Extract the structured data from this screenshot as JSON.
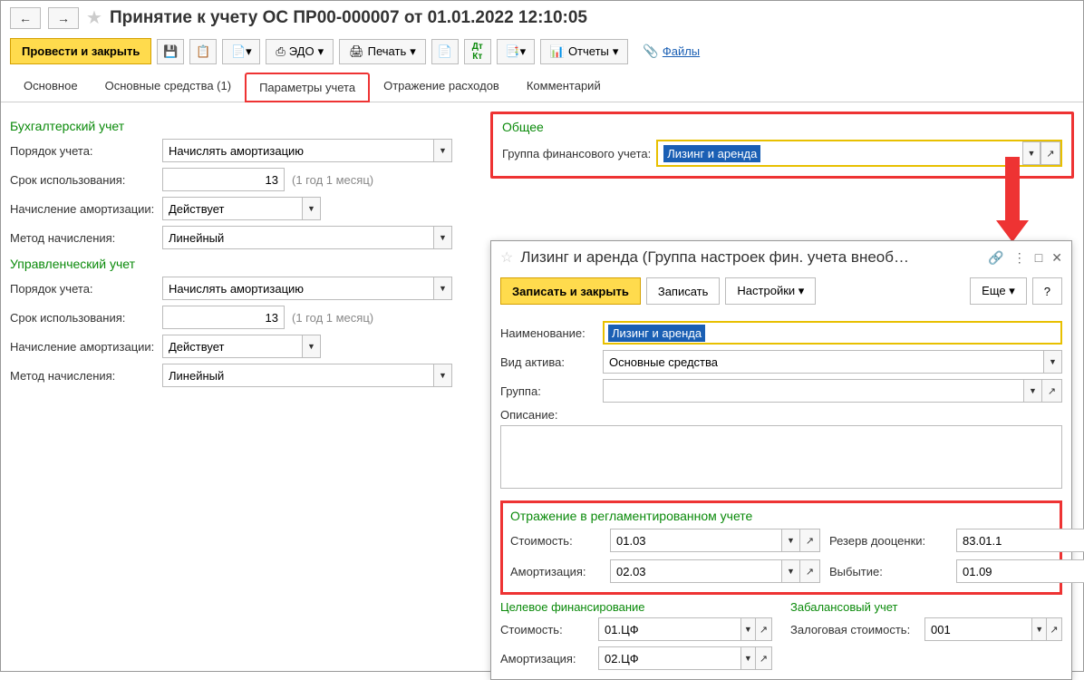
{
  "title": "Принятие к учету ОС ПР00-000007 от 01.01.2022 12:10:05",
  "toolbar": {
    "post_close": "Провести и закрыть",
    "edo": "ЭДО",
    "print": "Печать",
    "reports": "Отчеты",
    "files": "Файлы"
  },
  "tabs": {
    "main": "Основное",
    "assets": "Основные средства (1)",
    "params": "Параметры учета",
    "expenses": "Отражение расходов",
    "comment": "Комментарий"
  },
  "left": {
    "acc_title": "Бухгалтерский учет",
    "order_label": "Порядок учета:",
    "order_value": "Начислять амортизацию",
    "term_label": "Срок использования:",
    "term_value": "13",
    "term_hint": "(1 год 1 месяц)",
    "amort_label": "Начисление амортизации:",
    "amort_value": "Действует",
    "method_label": "Метод начисления:",
    "method_value": "Линейный",
    "mgmt_title": "Управленческий учет",
    "m_order_value": "Начислять амортизацию",
    "m_term_value": "13",
    "m_term_hint": "(1 год 1 месяц)",
    "m_amort_value": "Действует",
    "m_method_value": "Линейный"
  },
  "right": {
    "general_title": "Общее",
    "fingroup_label": "Группа финансового учета:",
    "fingroup_value": "Лизинг и аренда"
  },
  "popup": {
    "title": "Лизинг и аренда (Группа настроек фин. учета внеоб…",
    "save_close": "Записать и закрыть",
    "save": "Записать",
    "settings": "Настройки",
    "more": "Еще",
    "help": "?",
    "name_label": "Наименование:",
    "name_value": "Лизинг и аренда",
    "asset_type_label": "Вид актива:",
    "asset_type_value": "Основные средства",
    "group_label": "Группа:",
    "group_value": "",
    "desc_label": "Описание:",
    "desc_value": "",
    "reg_title": "Отражение в регламентированном учете",
    "cost_label": "Стоимость:",
    "cost_value": "01.03",
    "reserve_label": "Резерв дооценки:",
    "reserve_value": "83.01.1",
    "amort_label": "Амортизация:",
    "amort_value": "02.03",
    "disposal_label": "Выбытие:",
    "disposal_value": "01.09",
    "target_title": "Целевое финансирование",
    "t_cost_label": "Стоимость:",
    "t_cost_value": "01.ЦФ",
    "t_amort_label": "Амортизация:",
    "t_amort_value": "02.ЦФ",
    "offbal_title": "Забалансовый учет",
    "pledge_label": "Залоговая стоимость:",
    "pledge_value": "001"
  }
}
